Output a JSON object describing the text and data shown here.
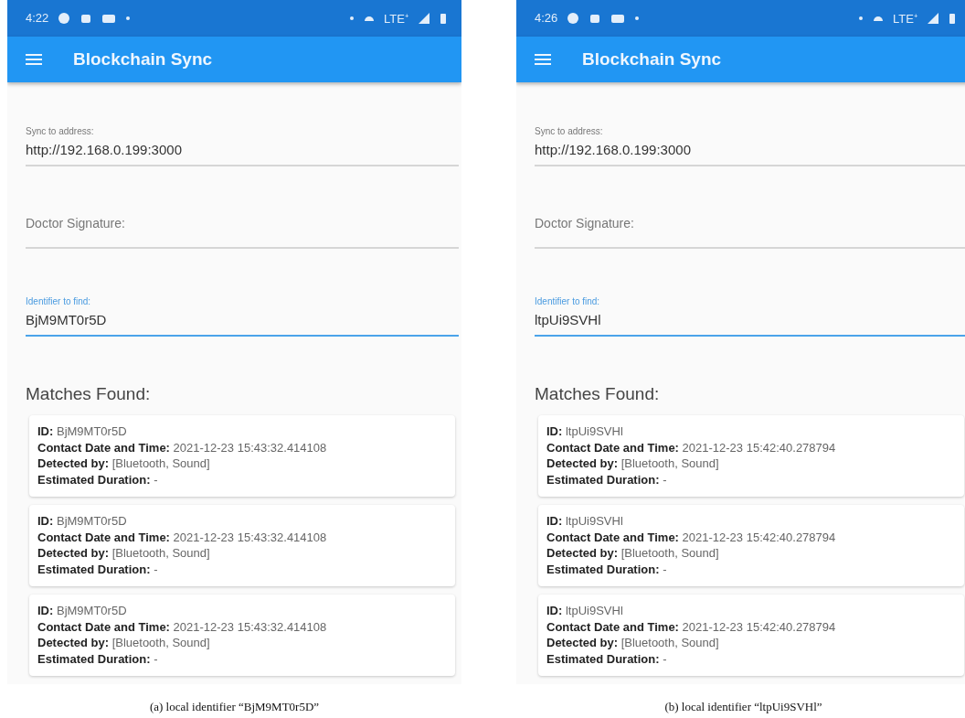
{
  "phones": [
    {
      "status_time": "4:22",
      "status_network": "LTE⁺",
      "title": "Blockchain Sync",
      "fields": [
        {
          "label": "Sync to address:",
          "value": "http://192.168.0.199:3000",
          "focused": false
        },
        {
          "label": "Doctor Signature:",
          "focused": false
        },
        {
          "label": "Identifier to find:",
          "value": "BjM9MT0r5D",
          "focused": true
        }
      ],
      "matches_title": "Matches Found:",
      "matches": [
        {
          "lines": [
            "**ID:** BjM9MT0r5D",
            "**Contact Date and Time:** 2021-12-23 15:43:32.414108",
            "**Detected by:** [Bluetooth,  Sound]",
            "**Estimated Duration:** -"
          ]
        },
        {
          "lines": [
            "**ID:** BjM9MT0r5D",
            "**Contact Date and Time:** 2021-12-23 15:43:32.414108",
            "**Detected by:** [Bluetooth,  Sound]",
            "**Estimated Duration:** -"
          ]
        },
        {
          "lines": [
            "**ID:** BjM9MT0r5D",
            "**Contact Date and Time:** 2021-12-23 15:43:32.414108",
            "**Detected by:** [Bluetooth,  Sound]",
            "**Estimated Duration:** -"
          ]
        }
      ],
      "caption": "(a) local identifier “BjM9MT0r5D”"
    },
    {
      "status_time": "4:26",
      "status_network": "LTE⁺",
      "title": "Blockchain Sync",
      "fields": [
        {
          "label": "Sync to address:",
          "value": "http://192.168.0.199:3000",
          "focused": false
        },
        {
          "label": "Doctor Signature:",
          "focused": false
        },
        {
          "label": "Identifier to find:",
          "value": "ltpUi9SVHl",
          "focused": true
        }
      ],
      "matches_title": "Matches Found:",
      "matches": [
        {
          "lines": [
            "**ID:** ltpUi9SVHl",
            "**Contact Date and Time:** 2021-12-23 15:42:40.278794",
            "**Detected by:** [Bluetooth,  Sound]",
            "**Estimated Duration:** -"
          ]
        },
        {
          "lines": [
            "**ID:** ltpUi9SVHl",
            "**Contact Date and Time:** 2021-12-23 15:42:40.278794",
            "**Detected by:** [Bluetooth,  Sound]",
            "**Estimated Duration:** -"
          ]
        },
        {
          "lines": [
            "**ID:** ltpUi9SVHl",
            "**Contact Date and Time:** 2021-12-23 15:42:40.278794",
            "**Detected by:** [Bluetooth,  Sound]",
            "**Estimated Duration:** -"
          ]
        }
      ],
      "caption": "(b) local identifier “ltpUi9SVHl”"
    }
  ]
}
